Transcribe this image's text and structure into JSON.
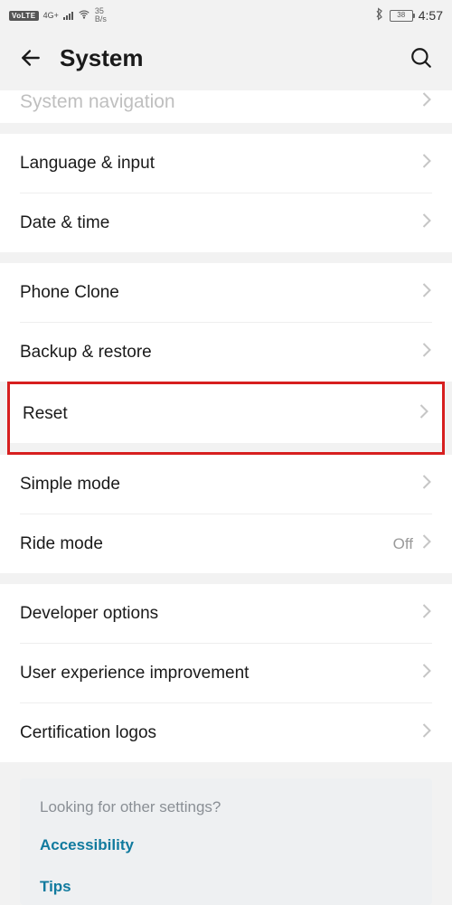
{
  "status": {
    "volte": "VoLTE",
    "net": "4G+",
    "speed_top": "35",
    "speed_bot": "B/s",
    "battery": "38",
    "time": "4:57"
  },
  "header": {
    "title": "System"
  },
  "partial": {
    "label": "System navigation"
  },
  "groups": [
    {
      "rows": [
        {
          "label": "Language & input",
          "value": ""
        },
        {
          "label": "Date & time",
          "value": ""
        }
      ]
    },
    {
      "rows": [
        {
          "label": "Phone Clone",
          "value": ""
        },
        {
          "label": "Backup & restore",
          "value": ""
        },
        {
          "label": "Reset",
          "value": "",
          "highlight": true
        }
      ]
    },
    {
      "rows": [
        {
          "label": "Simple mode",
          "value": ""
        },
        {
          "label": "Ride mode",
          "value": "Off"
        }
      ]
    },
    {
      "rows": [
        {
          "label": "Developer options",
          "value": ""
        },
        {
          "label": "User experience improvement",
          "value": ""
        },
        {
          "label": "Certification logos",
          "value": ""
        }
      ]
    }
  ],
  "suggest": {
    "title": "Looking for other settings?",
    "links": [
      "Accessibility",
      "Tips"
    ]
  }
}
